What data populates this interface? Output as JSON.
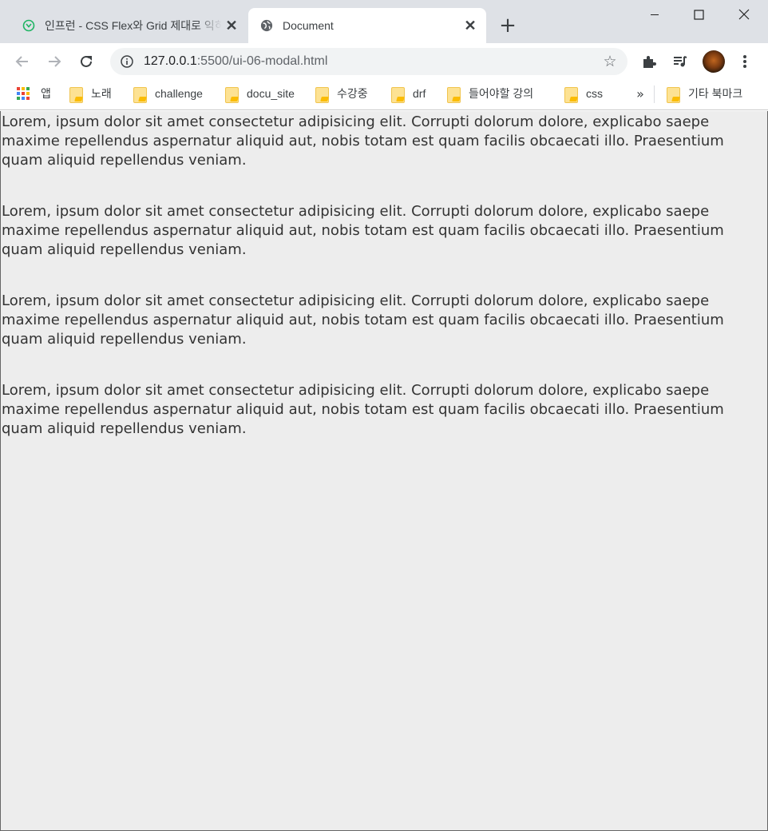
{
  "browser": {
    "tabs": [
      {
        "title": "인프런 - CSS Flex와 Grid 제대로 익히기",
        "favicon": "inflearn-icon",
        "active": false
      },
      {
        "title": "Document",
        "favicon": "globe-icon",
        "active": true
      }
    ],
    "new_tab_label": "+",
    "address": {
      "host": "127.0.0.1",
      "rest": ":5500/ui-06-modal.html"
    }
  },
  "bookmarks": {
    "apps_label": "앱",
    "items": [
      {
        "label": "노래"
      },
      {
        "label": "challenge"
      },
      {
        "label": "docu_site"
      },
      {
        "label": "수강중"
      },
      {
        "label": "drf"
      },
      {
        "label": "들어야할 강의"
      },
      {
        "label": "css"
      }
    ],
    "more_label": "»",
    "other_label": "기타 북마크"
  },
  "page": {
    "paragraphs": [
      "Lorem, ipsum dolor sit amet consectetur adipisicing elit. Corrupti dolorum dolore, explicabo saepe maxime repellendus aspernatur aliquid aut, nobis totam est quam facilis obcaecati illo. Praesentium quam aliquid repellendus veniam.",
      "Lorem, ipsum dolor sit amet consectetur adipisicing elit. Corrupti dolorum dolore, explicabo saepe maxime repellendus aspernatur aliquid aut, nobis totam est quam facilis obcaecati illo. Praesentium quam aliquid repellendus veniam.",
      "Lorem, ipsum dolor sit amet consectetur adipisicing elit. Corrupti dolorum dolore, explicabo saepe maxime repellendus aspernatur aliquid aut, nobis totam est quam facilis obcaecati illo. Praesentium quam aliquid repellendus veniam.",
      "Lorem, ipsum dolor sit amet consectetur adipisicing elit. Corrupti dolorum dolore, explicabo saepe maxime repellendus aspernatur aliquid aut, nobis totam est quam facilis obcaecati illo. Praesentium quam aliquid repellendus veniam."
    ],
    "background": "#ededed"
  },
  "colors": {
    "tabstrip": "#dee1e6",
    "omnibox": "#f1f3f4",
    "text": "#3c4043"
  }
}
